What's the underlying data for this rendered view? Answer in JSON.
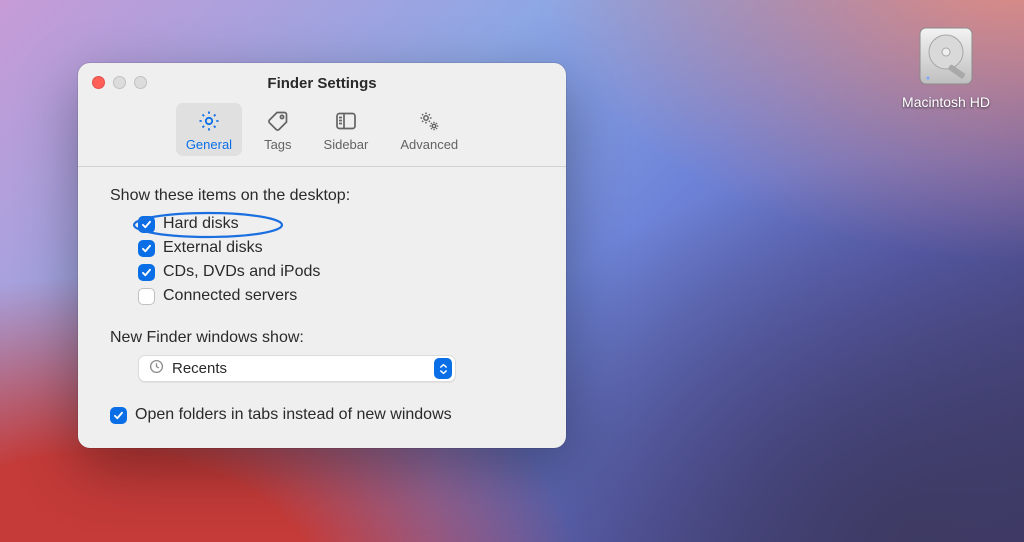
{
  "desktop": {
    "disk_label": "Macintosh HD"
  },
  "window": {
    "title": "Finder Settings",
    "tabs": [
      {
        "label": "General",
        "active": true
      },
      {
        "label": "Tags",
        "active": false
      },
      {
        "label": "Sidebar",
        "active": false
      },
      {
        "label": "Advanced",
        "active": false
      }
    ],
    "section1_label": "Show these items on the desktop:",
    "items": [
      {
        "label": "Hard disks",
        "checked": true,
        "highlighted": true
      },
      {
        "label": "External disks",
        "checked": true,
        "highlighted": false
      },
      {
        "label": "CDs, DVDs and iPods",
        "checked": true,
        "highlighted": false
      },
      {
        "label": "Connected servers",
        "checked": false,
        "highlighted": false
      }
    ],
    "section2_label": "New Finder windows show:",
    "select_value": "Recents",
    "tabs_checkbox": {
      "label": "Open folders in tabs instead of new windows",
      "checked": true
    }
  },
  "colors": {
    "accent": "#0a6fe6"
  }
}
